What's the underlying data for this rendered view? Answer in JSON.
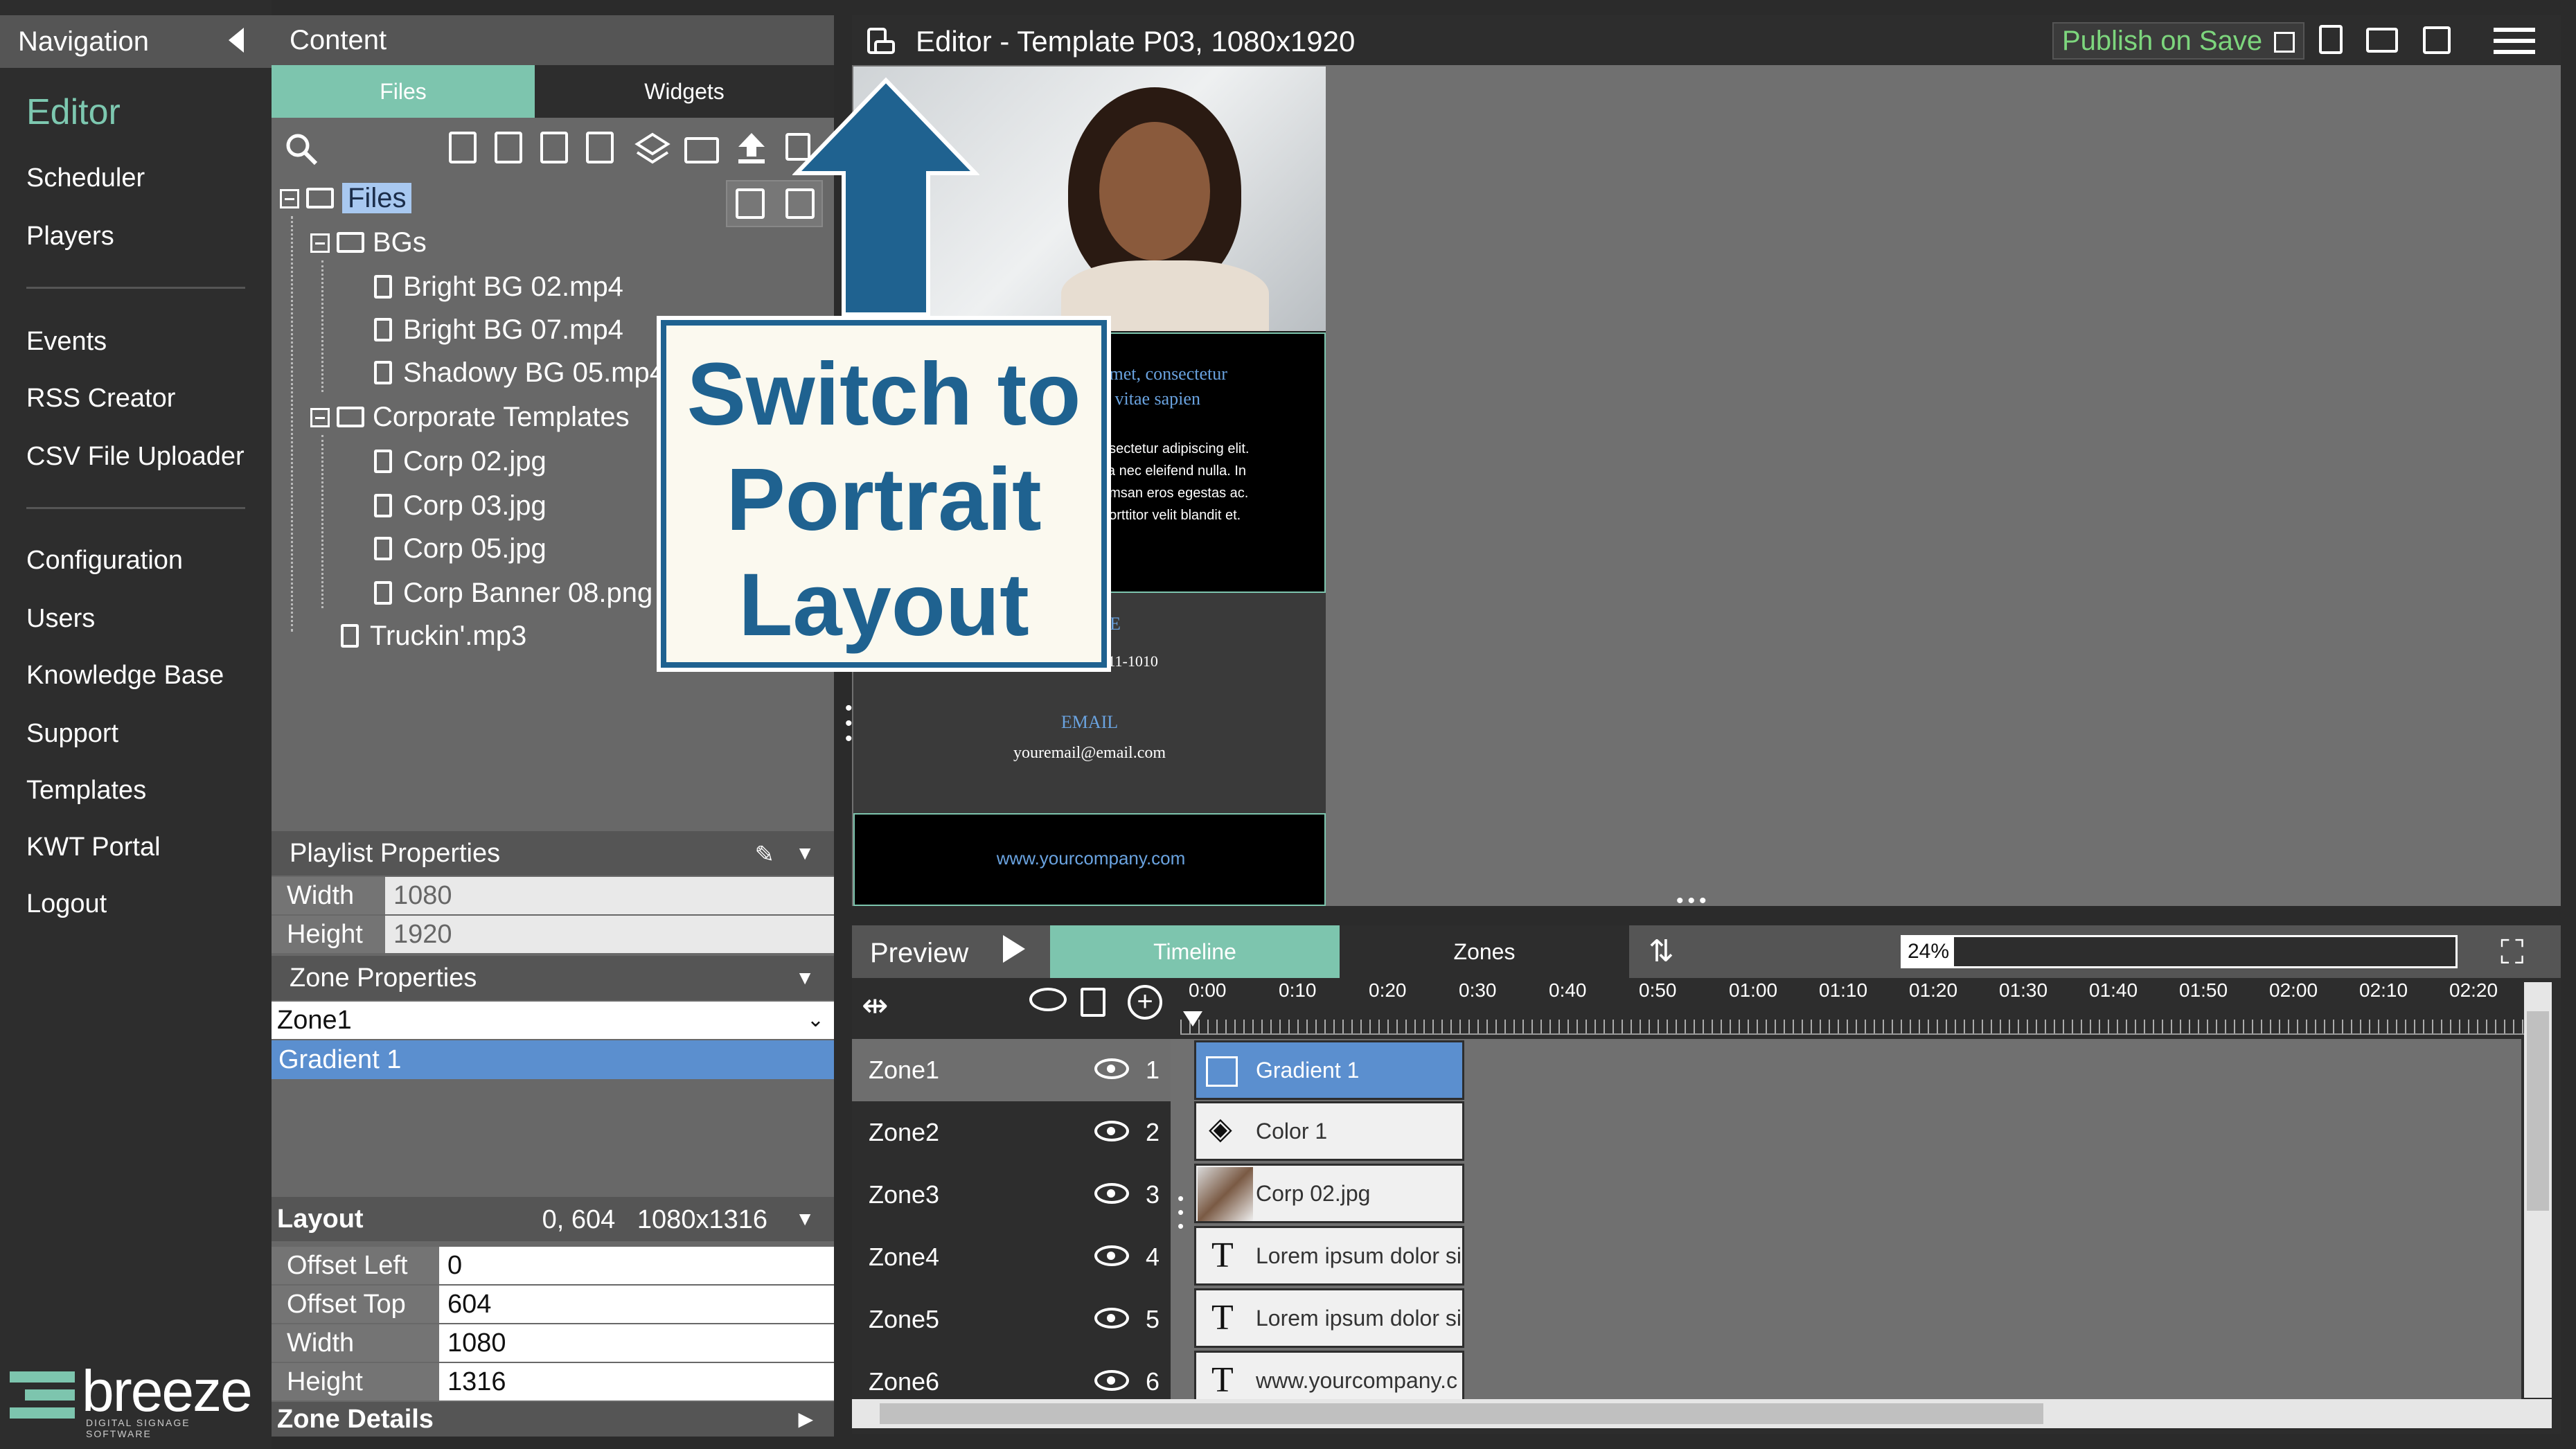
{
  "nav": {
    "title": "Navigation",
    "active": "Editor",
    "group1": [
      "Scheduler",
      "Players"
    ],
    "group2": [
      "Events",
      "RSS Creator",
      "CSV File Uploader"
    ],
    "group3": [
      "Configuration",
      "Users",
      "Knowledge Base",
      "Support",
      "Templates",
      "KWT Portal",
      "Logout"
    ],
    "logo_text": "breeze",
    "logo_sub": "DIGITAL SIGNAGE SOFTWARE"
  },
  "content": {
    "title": "Content",
    "tabs": {
      "files": "Files",
      "widgets": "Widgets"
    },
    "tree": {
      "root": "Files",
      "folder1": "BGs",
      "bgs": [
        "Bright BG 02.mp4",
        "Bright BG 07.mp4",
        "Shadowy BG 05.mp4"
      ],
      "folder2": "Corporate Templates",
      "corporate": [
        "Corp 02.jpg",
        "Corp 03.jpg",
        "Corp 05.jpg",
        "Corp Banner 08.png"
      ],
      "loose": "Truckin'.mp3"
    }
  },
  "playlist": {
    "title": "Playlist Properties",
    "width_label": "Width",
    "width_value": "1080",
    "height_label": "Height",
    "height_value": "1920"
  },
  "zone_props": {
    "title": "Zone Properties",
    "selected_zone": "Zone1",
    "selected_item": "Gradient 1"
  },
  "layout": {
    "title": "Layout",
    "summary": "0, 604   1080x1316",
    "offset_left_label": "Offset Left",
    "offset_left": "0",
    "offset_top_label": "Offset Top",
    "offset_top": "604",
    "width_label": "Width",
    "width": "1080",
    "height_label": "Height",
    "height": "1316"
  },
  "zone_details": "Zone Details",
  "editor": {
    "title": "Editor - Template P03, 1080x1920",
    "publish": "Publish on Save"
  },
  "template_preview": {
    "headline": "amet, consectetur\nd vitae sapien",
    "body": "nsectetur adipiscing elit.\nlla nec eleifend nulla. In\numsan eros egestas ac.\nporttitor velit blandit et.",
    "phone_label": "E",
    "phone": "1-555-1-111-1010",
    "email_label": "EMAIL",
    "email": "youremail@email.com",
    "website": "www.yourcompany.com"
  },
  "callout": {
    "text": "Switch to Portrait Layout"
  },
  "preview": {
    "title": "Preview",
    "tab_timeline": "Timeline",
    "tab_zones": "Zones",
    "zoom": "24%",
    "ticks": [
      "0:00",
      "0:10",
      "0:20",
      "0:30",
      "0:40",
      "0:50",
      "01:00",
      "01:10",
      "01:20",
      "01:30",
      "01:40",
      "01:50",
      "02:00",
      "02:10",
      "02:20"
    ],
    "zones": [
      {
        "name": "Zone1",
        "num": "1",
        "clip": "Gradient 1"
      },
      {
        "name": "Zone2",
        "num": "2",
        "clip": "Color 1"
      },
      {
        "name": "Zone3",
        "num": "3",
        "clip": "Corp 02.jpg"
      },
      {
        "name": "Zone4",
        "num": "4",
        "clip": "Lorem ipsum dolor si"
      },
      {
        "name": "Zone5",
        "num": "5",
        "clip": "Lorem ipsum dolor si"
      },
      {
        "name": "Zone6",
        "num": "6",
        "clip": "www.yourcompany.c"
      }
    ]
  },
  "colors": {
    "accent": "#7dc5ae",
    "callout_blue": "#1f6290",
    "select_blue": "#5b8fcf"
  }
}
